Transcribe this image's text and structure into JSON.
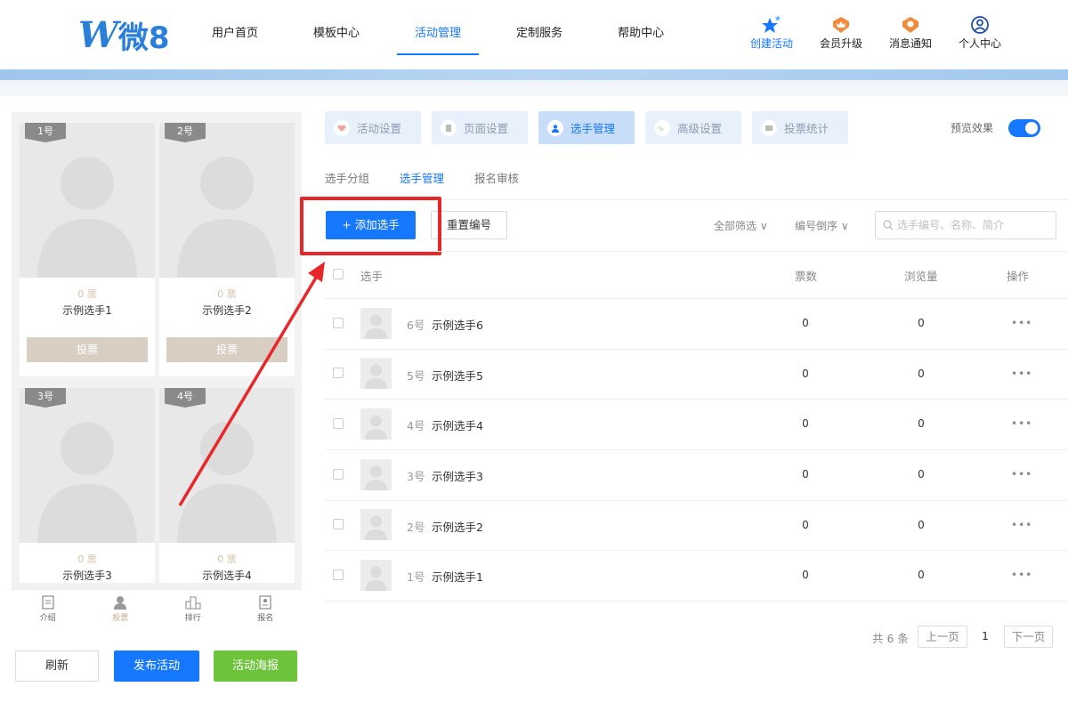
{
  "brand": {
    "logo_letter": "W",
    "logo_text": "微8"
  },
  "nav": {
    "items": [
      {
        "label": "用户首页",
        "active": false
      },
      {
        "label": "模板中心",
        "active": false
      },
      {
        "label": "活动管理",
        "active": true
      },
      {
        "label": "定制服务",
        "active": false
      },
      {
        "label": "帮助中心",
        "active": false
      }
    ]
  },
  "tools": {
    "create": "创建活动",
    "upgrade": "会员升级",
    "notice": "消息通知",
    "profile": "个人中心"
  },
  "preview": {
    "cards": [
      {
        "badge": "1号",
        "votes": "0 票",
        "name": "示例选手1",
        "vote_label": "投票"
      },
      {
        "badge": "2号",
        "votes": "0 票",
        "name": "示例选手2",
        "vote_label": "投票"
      },
      {
        "badge": "3号",
        "votes": "0 票",
        "name": "示例选手3"
      },
      {
        "badge": "4号",
        "votes": "0 票",
        "name": "示例选手4"
      }
    ],
    "bottom_nav": [
      "介绍",
      "投票",
      "排行",
      "报名"
    ]
  },
  "actions": {
    "refresh": "刷新",
    "publish": "发布活动",
    "poster": "活动海报"
  },
  "tabs": [
    {
      "label": "活动设置",
      "active": false
    },
    {
      "label": "页面设置",
      "active": false
    },
    {
      "label": "选手管理",
      "active": true
    },
    {
      "label": "高级设置",
      "active": false
    },
    {
      "label": "投票统计",
      "active": false
    }
  ],
  "preview_toggle": {
    "label": "预览效果",
    "on": true
  },
  "subtabs": [
    {
      "label": "选手分组",
      "active": false
    },
    {
      "label": "选手管理",
      "active": true
    },
    {
      "label": "报名审核",
      "active": false
    }
  ],
  "toolbar": {
    "add_label": "+ 添加选手",
    "reset_label": "重置编号",
    "filter_all": "全部筛选 ∨",
    "sort_label": "编号倒序 ∨",
    "search_placeholder": "选手编号、名称、简介"
  },
  "table": {
    "headers": {
      "player": "选手",
      "votes": "票数",
      "views": "浏览量",
      "ops": "操作"
    },
    "rows": [
      {
        "num": "6号",
        "name": "示例选手6",
        "votes": "0",
        "views": "0",
        "more": "•••"
      },
      {
        "num": "5号",
        "name": "示例选手5",
        "votes": "0",
        "views": "0",
        "more": "•••"
      },
      {
        "num": "4号",
        "name": "示例选手4",
        "votes": "0",
        "views": "0",
        "more": "•••"
      },
      {
        "num": "3号",
        "name": "示例选手3",
        "votes": "0",
        "views": "0",
        "more": "•••"
      },
      {
        "num": "2号",
        "name": "示例选手2",
        "votes": "0",
        "views": "0",
        "more": "•••"
      },
      {
        "num": "1号",
        "name": "示例选手1",
        "votes": "0",
        "views": "0",
        "more": "•••"
      }
    ]
  },
  "pager": {
    "total": "共 6 条",
    "prev": "上一页",
    "current": "1",
    "next": "下一页"
  },
  "colors": {
    "primary": "#1677ff",
    "highlight": "#e8272b",
    "poster_green": "#6dc33a"
  }
}
